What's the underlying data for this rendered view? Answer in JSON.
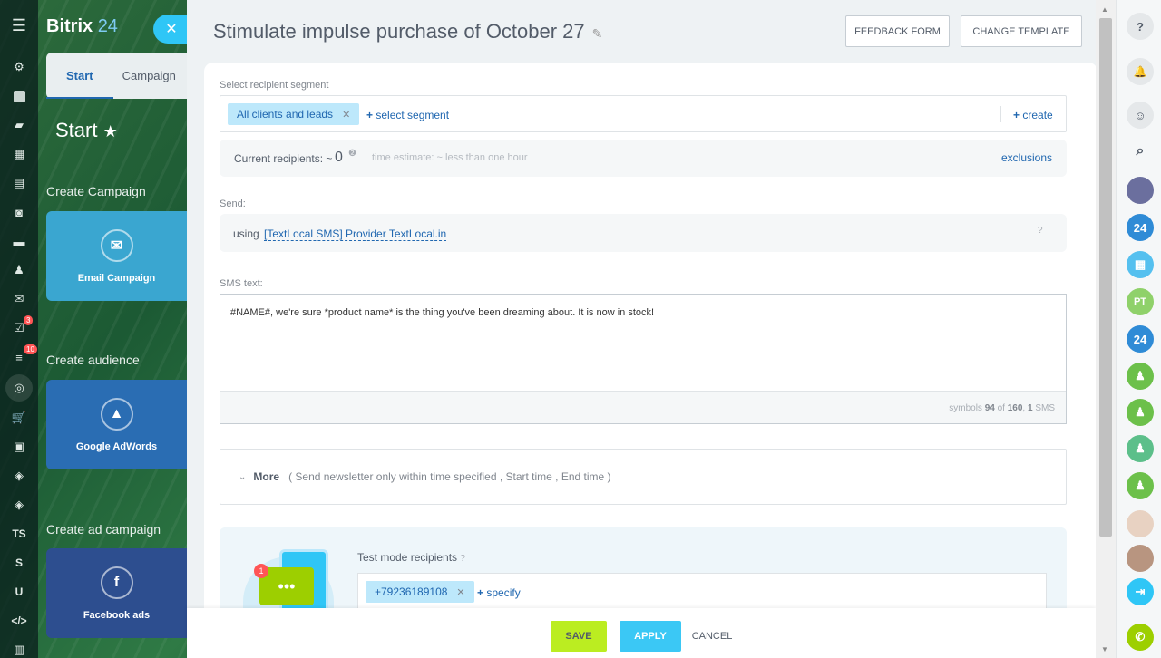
{
  "brand": {
    "name": "Bitrix",
    "num": "24"
  },
  "left_panel": {
    "tabs": [
      {
        "label": "Start"
      },
      {
        "label": "Campaign"
      }
    ],
    "start_title": "Start",
    "sections": [
      {
        "title": "Create Campaign",
        "tile": "Email Campaign"
      },
      {
        "title": "Create audience",
        "tile": "Google AdWords"
      },
      {
        "title": "Create ad campaign",
        "tile": "Facebook ads"
      }
    ]
  },
  "nav": {
    "badge_tasks": "3",
    "badge_feed": "10",
    "ts": "TS",
    "s": "S",
    "u": "U",
    "code": "</>"
  },
  "header": {
    "title": "Stimulate impulse purchase of October 27",
    "feedback": "FEEDBACK FORM",
    "change_template": "CHANGE TEMPLATE"
  },
  "segment": {
    "label": "Select recipient segment",
    "chip": "All clients and leads",
    "select": "select segment",
    "create": "create"
  },
  "recipients": {
    "label": "Current recipients: ~",
    "count": "0",
    "estimate": "time estimate: ~ less than one hour",
    "exclusions": "exclusions"
  },
  "send": {
    "label": "Send:",
    "using": "using",
    "provider": "[TextLocal SMS] Provider TextLocal.in"
  },
  "sms": {
    "label": "SMS text:",
    "text": "#NAME#, we're sure *product name* is the thing you've been dreaming about. It is now in stock!",
    "symbols_prefix": "symbols",
    "symbols": "94",
    "of": "of",
    "max": "160",
    "sep": ",",
    "sms_count": "1",
    "sms_word": "SMS"
  },
  "more": {
    "label": "More",
    "detail": "( Send newsletter only within time specified ,  Start time ,  End time  )"
  },
  "test": {
    "label": "Test mode recipients",
    "phone": "+79236189108",
    "specify": "specify",
    "notif": "1"
  },
  "footer": {
    "save": "SAVE",
    "apply": "APPLY",
    "cancel": "CANCEL"
  },
  "rightbar": {
    "b24a": "24",
    "pt": "PT",
    "b24b": "24"
  },
  "colors": {
    "accent": "#2fc6f6",
    "save": "#bbed21",
    "link": "#2067b0",
    "green": "#6cc04a"
  }
}
